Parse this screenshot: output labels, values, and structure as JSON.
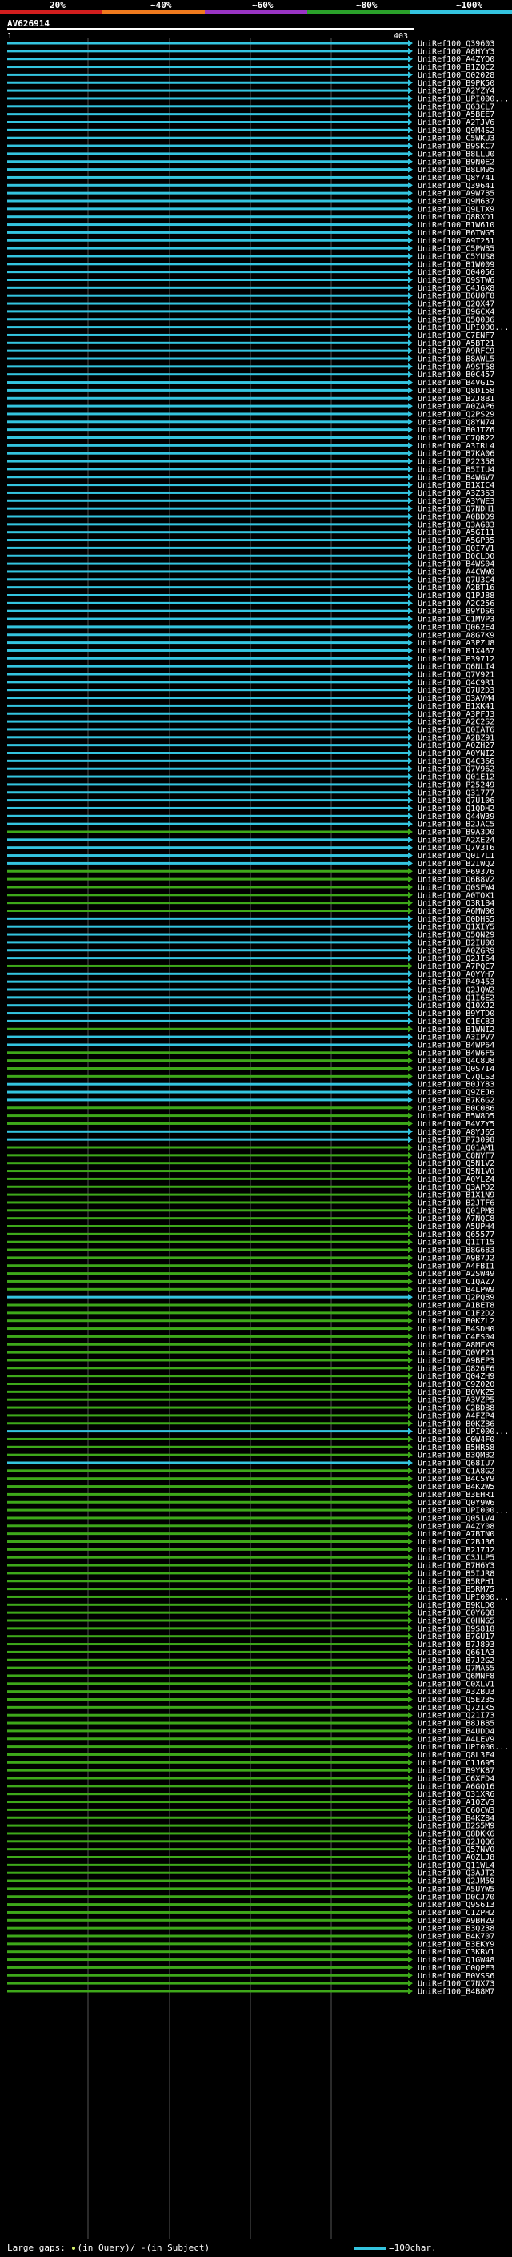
{
  "scale": {
    "labels": [
      "20%",
      "~40%",
      "~60%",
      "~80%",
      "~100%"
    ],
    "colors": [
      "#d21e1e",
      "#f07a1e",
      "#9934c4",
      "#2aa12a",
      "#34c4df"
    ]
  },
  "query": {
    "id": "AV626914",
    "start_label": "1",
    "end_label": "403"
  },
  "colors": {
    "cyan": "#34c4df",
    "green": "#3ea81a",
    "gap": "#d7f26b",
    "grid": "#555555"
  },
  "hits": [
    {
      "id": "UniRef100_Q39603",
      "c": "cyan"
    },
    {
      "id": "UniRef100_A8HYY3",
      "c": "cyan"
    },
    {
      "id": "UniRef100_A4ZYQ0",
      "c": "cyan"
    },
    {
      "id": "UniRef100_B1ZQC2",
      "c": "cyan"
    },
    {
      "id": "UniRef100_Q02028",
      "c": "cyan"
    },
    {
      "id": "UniRef100_B9PK50",
      "c": "cyan"
    },
    {
      "id": "UniRef100_A2YZY4",
      "c": "cyan"
    },
    {
      "id": "UniRef100_UPI000...",
      "c": "cyan"
    },
    {
      "id": "UniRef100_Q63CL7",
      "c": "cyan"
    },
    {
      "id": "UniRef100_A5BEE7",
      "c": "cyan"
    },
    {
      "id": "UniRef100_A2TJV6",
      "c": "cyan"
    },
    {
      "id": "UniRef100_Q9M4S2",
      "c": "cyan"
    },
    {
      "id": "UniRef100_C5WKU3",
      "c": "cyan"
    },
    {
      "id": "UniRef100_B9SKC7",
      "c": "cyan"
    },
    {
      "id": "UniRef100_B8LLU0",
      "c": "cyan"
    },
    {
      "id": "UniRef100_B9N0E2",
      "c": "cyan"
    },
    {
      "id": "UniRef100_B8LM95",
      "c": "cyan"
    },
    {
      "id": "UniRef100_Q8Y741",
      "c": "cyan"
    },
    {
      "id": "UniRef100_Q39641",
      "c": "cyan"
    },
    {
      "id": "UniRef100_A9W7B5",
      "c": "cyan"
    },
    {
      "id": "UniRef100_Q9M637",
      "c": "cyan"
    },
    {
      "id": "UniRef100_Q9LTX9",
      "c": "cyan"
    },
    {
      "id": "UniRef100_Q8RXD1",
      "c": "cyan"
    },
    {
      "id": "UniRef100_B1W610",
      "c": "cyan"
    },
    {
      "id": "UniRef100_B6TWG5",
      "c": "cyan"
    },
    {
      "id": "UniRef100_A9T251",
      "c": "cyan"
    },
    {
      "id": "UniRef100_C5PWB5",
      "c": "cyan"
    },
    {
      "id": "UniRef100_C5YUS8",
      "c": "cyan"
    },
    {
      "id": "UniRef100_B1W009",
      "c": "cyan"
    },
    {
      "id": "UniRef100_Q04056",
      "c": "cyan"
    },
    {
      "id": "UniRef100_Q9STW6",
      "c": "cyan"
    },
    {
      "id": "UniRef100_C4J6X8",
      "c": "cyan"
    },
    {
      "id": "UniRef100_B6U0F8",
      "c": "cyan"
    },
    {
      "id": "UniRef100_Q2QX47",
      "c": "cyan"
    },
    {
      "id": "UniRef100_B9GCX4",
      "c": "cyan"
    },
    {
      "id": "UniRef100_Q5Q036",
      "c": "cyan"
    },
    {
      "id": "UniRef100_UPI000...",
      "c": "cyan"
    },
    {
      "id": "UniRef100_C7ENF7",
      "c": "cyan"
    },
    {
      "id": "UniRef100_A5BT21",
      "c": "cyan"
    },
    {
      "id": "UniRef100_A9RFC9",
      "c": "cyan"
    },
    {
      "id": "UniRef100_B8AWL5",
      "c": "cyan"
    },
    {
      "id": "UniRef100_A9ST58",
      "c": "cyan"
    },
    {
      "id": "UniRef100_B0C457",
      "c": "cyan"
    },
    {
      "id": "UniRef100_B4VG15",
      "c": "cyan"
    },
    {
      "id": "UniRef100_Q8D158",
      "c": "cyan"
    },
    {
      "id": "UniRef100_B2J8B1",
      "c": "cyan"
    },
    {
      "id": "UniRef100_A0ZAP6",
      "c": "cyan"
    },
    {
      "id": "UniRef100_Q2PS29",
      "c": "cyan"
    },
    {
      "id": "UniRef100_Q8YN74",
      "c": "cyan"
    },
    {
      "id": "UniRef100_B0JTZ6",
      "c": "cyan"
    },
    {
      "id": "UniRef100_C7QR22",
      "c": "cyan"
    },
    {
      "id": "UniRef100_A3IRL4",
      "c": "cyan"
    },
    {
      "id": "UniRef100_B7KA06",
      "c": "cyan"
    },
    {
      "id": "UniRef100_P22358",
      "c": "cyan"
    },
    {
      "id": "UniRef100_B5IIU4",
      "c": "cyan"
    },
    {
      "id": "UniRef100_B4WGV7",
      "c": "cyan"
    },
    {
      "id": "UniRef100_B1XIC4",
      "c": "cyan"
    },
    {
      "id": "UniRef100_A3Z3S3",
      "c": "cyan"
    },
    {
      "id": "UniRef100_A3YWE3",
      "c": "cyan"
    },
    {
      "id": "UniRef100_Q7NDH1",
      "c": "cyan"
    },
    {
      "id": "UniRef100_A0BDD9",
      "c": "cyan"
    },
    {
      "id": "UniRef100_Q3AG83",
      "c": "cyan"
    },
    {
      "id": "UniRef100_A5GI11",
      "c": "cyan"
    },
    {
      "id": "UniRef100_A5GP35",
      "c": "cyan"
    },
    {
      "id": "UniRef100_Q0I7V1",
      "c": "cyan"
    },
    {
      "id": "UniRef100_D0CLD0",
      "c": "cyan"
    },
    {
      "id": "UniRef100_B4WS04",
      "c": "cyan"
    },
    {
      "id": "UniRef100_A4CWW0",
      "c": "cyan"
    },
    {
      "id": "UniRef100_Q7U3C4",
      "c": "cyan"
    },
    {
      "id": "UniRef100_A2BT16",
      "c": "cyan"
    },
    {
      "id": "UniRef100_Q1PJ88",
      "c": "cyan"
    },
    {
      "id": "UniRef100_A2C256",
      "c": "cyan"
    },
    {
      "id": "UniRef100_B9YDS6",
      "c": "cyan"
    },
    {
      "id": "UniRef100_C1MVP3",
      "c": "cyan"
    },
    {
      "id": "UniRef100_Q062E4",
      "c": "cyan"
    },
    {
      "id": "UniRef100_A8G7K9",
      "c": "cyan"
    },
    {
      "id": "UniRef100_A3PZU8",
      "c": "cyan"
    },
    {
      "id": "UniRef100_B1X467",
      "c": "cyan"
    },
    {
      "id": "UniRef100_P39712",
      "c": "cyan"
    },
    {
      "id": "UniRef100_Q6NLI4",
      "c": "cyan"
    },
    {
      "id": "UniRef100_Q7V921",
      "c": "cyan"
    },
    {
      "id": "UniRef100_Q4C9R1",
      "c": "cyan"
    },
    {
      "id": "UniRef100_Q7U2D3",
      "c": "cyan"
    },
    {
      "id": "UniRef100_Q3AVM4",
      "c": "cyan"
    },
    {
      "id": "UniRef100_B1XK41",
      "c": "cyan"
    },
    {
      "id": "UniRef100_A3PFJ3",
      "c": "cyan"
    },
    {
      "id": "UniRef100_A2C2S2",
      "c": "cyan"
    },
    {
      "id": "UniRef100_Q0IAT6",
      "c": "cyan"
    },
    {
      "id": "UniRef100_A2BZ91",
      "c": "cyan"
    },
    {
      "id": "UniRef100_A0ZH27",
      "c": "cyan"
    },
    {
      "id": "UniRef100_A0YNI2",
      "c": "cyan"
    },
    {
      "id": "UniRef100_Q4C366",
      "c": "cyan"
    },
    {
      "id": "UniRef100_Q7V962",
      "c": "cyan"
    },
    {
      "id": "UniRef100_Q01E12",
      "c": "cyan"
    },
    {
      "id": "UniRef100_P25249",
      "c": "cyan"
    },
    {
      "id": "UniRef100_Q31777",
      "c": "cyan"
    },
    {
      "id": "UniRef100_Q7U106",
      "c": "cyan"
    },
    {
      "id": "UniRef100_Q1QDH2",
      "c": "cyan"
    },
    {
      "id": "UniRef100_Q44W39",
      "c": "cyan"
    },
    {
      "id": "UniRef100_B2JAC5",
      "c": "cyan"
    },
    {
      "id": "UniRef100_B9A3D0",
      "c": "green"
    },
    {
      "id": "UniRef100_A2XE24",
      "c": "cyan"
    },
    {
      "id": "UniRef100_Q7V3T6",
      "c": "cyan"
    },
    {
      "id": "UniRef100_Q0I7L1",
      "c": "cyan"
    },
    {
      "id": "UniRef100_B2IWQ2",
      "c": "cyan"
    },
    {
      "id": "UniRef100_P69376",
      "c": "green"
    },
    {
      "id": "UniRef100_Q6B8V2",
      "c": "green"
    },
    {
      "id": "UniRef100_Q0SFW4",
      "c": "green"
    },
    {
      "id": "UniRef100_A0TOX1",
      "c": "green"
    },
    {
      "id": "UniRef100_Q3R1B4",
      "c": "green"
    },
    {
      "id": "UniRef100_A6MW00",
      "c": "green"
    },
    {
      "id": "UniRef100_Q0DHS5",
      "c": "cyan"
    },
    {
      "id": "UniRef100_Q1XIY5",
      "c": "cyan"
    },
    {
      "id": "UniRef100_Q5QN29",
      "c": "cyan"
    },
    {
      "id": "UniRef100_B2IU00",
      "c": "cyan"
    },
    {
      "id": "UniRef100_A0ZGR9",
      "c": "cyan"
    },
    {
      "id": "UniRef100_Q2JI64",
      "c": "cyan"
    },
    {
      "id": "UniRef100_A7PQC7",
      "c": "green"
    },
    {
      "id": "UniRef100_A0YYH7",
      "c": "cyan"
    },
    {
      "id": "UniRef100_P49453",
      "c": "cyan"
    },
    {
      "id": "UniRef100_Q2JQW2",
      "c": "cyan"
    },
    {
      "id": "UniRef100_Q1I6E2",
      "c": "cyan"
    },
    {
      "id": "UniRef100_Q10XJ2",
      "c": "cyan"
    },
    {
      "id": "UniRef100_B9YTD0",
      "c": "cyan"
    },
    {
      "id": "UniRef100_C1EC83",
      "c": "cyan"
    },
    {
      "id": "UniRef100_B1WNI2",
      "c": "green"
    },
    {
      "id": "UniRef100_A3IPV7",
      "c": "cyan"
    },
    {
      "id": "UniRef100_B4WP64",
      "c": "cyan"
    },
    {
      "id": "UniRef100_B4W6F5",
      "c": "green"
    },
    {
      "id": "UniRef100_Q4C8U8",
      "c": "green"
    },
    {
      "id": "UniRef100_Q0S7I4",
      "c": "green"
    },
    {
      "id": "UniRef100_C7QLS3",
      "c": "green"
    },
    {
      "id": "UniRef100_B0JY83",
      "c": "cyan"
    },
    {
      "id": "UniRef100_Q9ZEJ6",
      "c": "cyan"
    },
    {
      "id": "UniRef100_B7K6G2",
      "c": "cyan"
    },
    {
      "id": "UniRef100_B0C086",
      "c": "green"
    },
    {
      "id": "UniRef100_B5W8D5",
      "c": "green"
    },
    {
      "id": "UniRef100_B4VZY5",
      "c": "green"
    },
    {
      "id": "UniRef100_A8YJ65",
      "c": "cyan"
    },
    {
      "id": "UniRef100_P73098",
      "c": "cyan"
    },
    {
      "id": "UniRef100_Q01AM1",
      "c": "green"
    },
    {
      "id": "UniRef100_C8NYF7",
      "c": "green"
    },
    {
      "id": "UniRef100_Q5N1V2",
      "c": "green"
    },
    {
      "id": "UniRef100_Q5N1V0",
      "c": "green"
    },
    {
      "id": "UniRef100_A0YLZ4",
      "c": "green"
    },
    {
      "id": "UniRef100_Q3APD2",
      "c": "green"
    },
    {
      "id": "UniRef100_B1X1N9",
      "c": "green"
    },
    {
      "id": "UniRef100_B2JTF6",
      "c": "green"
    },
    {
      "id": "UniRef100_Q01PM8",
      "c": "green"
    },
    {
      "id": "UniRef100_A7NQC8",
      "c": "green"
    },
    {
      "id": "UniRef100_A5UPH4",
      "c": "green"
    },
    {
      "id": "UniRef100_Q65577",
      "c": "green"
    },
    {
      "id": "UniRef100_Q1IT15",
      "c": "green"
    },
    {
      "id": "UniRef100_B8G683",
      "c": "green"
    },
    {
      "id": "UniRef100_A9B7J2",
      "c": "green"
    },
    {
      "id": "UniRef100_A4FBI1",
      "c": "green"
    },
    {
      "id": "UniRef100_A2SW49",
      "c": "green"
    },
    {
      "id": "UniRef100_C1QAZ7",
      "c": "green"
    },
    {
      "id": "UniRef100_B4LPW9",
      "c": "green"
    },
    {
      "id": "UniRef100_Q2PQB9",
      "c": "cyan"
    },
    {
      "id": "UniRef100_A1BET8",
      "c": "green"
    },
    {
      "id": "UniRef100_C1F2D2",
      "c": "green"
    },
    {
      "id": "UniRef100_B0KZL2",
      "c": "green"
    },
    {
      "id": "UniRef100_B4SDH0",
      "c": "green"
    },
    {
      "id": "UniRef100_C4ES04",
      "c": "green"
    },
    {
      "id": "UniRef100_A8MFV9",
      "c": "green"
    },
    {
      "id": "UniRef100_Q0VP21",
      "c": "green"
    },
    {
      "id": "UniRef100_A9BEP3",
      "c": "green"
    },
    {
      "id": "UniRef100_Q826F6",
      "c": "green"
    },
    {
      "id": "UniRef100_Q04ZH9",
      "c": "green"
    },
    {
      "id": "UniRef100_C9Z020",
      "c": "green"
    },
    {
      "id": "UniRef100_B0VKZ5",
      "c": "green"
    },
    {
      "id": "UniRef100_A3VZP5",
      "c": "green"
    },
    {
      "id": "UniRef100_C2BDB8",
      "c": "green"
    },
    {
      "id": "UniRef100_A4FZP4",
      "c": "green"
    },
    {
      "id": "UniRef100_B0KZB6",
      "c": "green"
    },
    {
      "id": "UniRef100_UPI000...",
      "c": "cyan"
    },
    {
      "id": "UniRef100_C0W4F0",
      "c": "green"
    },
    {
      "id": "UniRef100_B5HR58",
      "c": "green"
    },
    {
      "id": "UniRef100_B3QMB2",
      "c": "green"
    },
    {
      "id": "UniRef100_Q68IU7",
      "c": "cyan"
    },
    {
      "id": "UniRef100_C1A8G2",
      "c": "green"
    },
    {
      "id": "UniRef100_B4CSY9",
      "c": "green"
    },
    {
      "id": "UniRef100_B4K2W5",
      "c": "green"
    },
    {
      "id": "UniRef100_B3EHR1",
      "c": "green"
    },
    {
      "id": "UniRef100_Q0Y9W6",
      "c": "green"
    },
    {
      "id": "UniRef100_UPI000...",
      "c": "green"
    },
    {
      "id": "UniRef100_Q051V4",
      "c": "green"
    },
    {
      "id": "UniRef100_A4ZY08",
      "c": "green"
    },
    {
      "id": "UniRef100_A7BTN0",
      "c": "green"
    },
    {
      "id": "UniRef100_C2BJ36",
      "c": "green"
    },
    {
      "id": "UniRef100_B2J7J2",
      "c": "green"
    },
    {
      "id": "UniRef100_C3JLP5",
      "c": "green"
    },
    {
      "id": "UniRef100_B7H6Y3",
      "c": "green"
    },
    {
      "id": "UniRef100_B5IJR8",
      "c": "green"
    },
    {
      "id": "UniRef100_B5RPH1",
      "c": "green"
    },
    {
      "id": "UniRef100_B5RM75",
      "c": "green"
    },
    {
      "id": "UniRef100_UPI000...",
      "c": "green"
    },
    {
      "id": "UniRef100_B9KLD0",
      "c": "green"
    },
    {
      "id": "UniRef100_C0Y6Q8",
      "c": "green"
    },
    {
      "id": "UniRef100_C0HNG5",
      "c": "green"
    },
    {
      "id": "UniRef100_B9S818",
      "c": "green"
    },
    {
      "id": "UniRef100_B7GU17",
      "c": "green"
    },
    {
      "id": "UniRef100_B7J893",
      "c": "green"
    },
    {
      "id": "UniRef100_Q661A3",
      "c": "green"
    },
    {
      "id": "UniRef100_B7J2G2",
      "c": "green"
    },
    {
      "id": "UniRef100_Q7MA55",
      "c": "green"
    },
    {
      "id": "UniRef100_Q6MNF8",
      "c": "green"
    },
    {
      "id": "UniRef100_C0XLV1",
      "c": "green"
    },
    {
      "id": "UniRef100_A3ZBU3",
      "c": "green"
    },
    {
      "id": "UniRef100_Q5E235",
      "c": "green"
    },
    {
      "id": "UniRef100_Q72IK5",
      "c": "green"
    },
    {
      "id": "UniRef100_Q21I73",
      "c": "green"
    },
    {
      "id": "UniRef100_B8JBB5",
      "c": "green"
    },
    {
      "id": "UniRef100_B4UDD4",
      "c": "green"
    },
    {
      "id": "UniRef100_A4LEV9",
      "c": "green"
    },
    {
      "id": "UniRef100_UPI000...",
      "c": "green"
    },
    {
      "id": "UniRef100_Q8L3F4",
      "c": "green"
    },
    {
      "id": "UniRef100_C1J695",
      "c": "green"
    },
    {
      "id": "UniRef100_B9YK87",
      "c": "green"
    },
    {
      "id": "UniRef100_C6XFD4",
      "c": "green"
    },
    {
      "id": "UniRef100_A6GQ16",
      "c": "green"
    },
    {
      "id": "UniRef100_Q31XR6",
      "c": "green"
    },
    {
      "id": "UniRef100_A1QZV3",
      "c": "green"
    },
    {
      "id": "UniRef100_C6QCW3",
      "c": "green"
    },
    {
      "id": "UniRef100_B4KZ84",
      "c": "green"
    },
    {
      "id": "UniRef100_B2S5M9",
      "c": "green"
    },
    {
      "id": "UniRef100_Q8DKK6",
      "c": "green"
    },
    {
      "id": "UniRef100_Q2JQQ6",
      "c": "green"
    },
    {
      "id": "UniRef100_Q57NV0",
      "c": "green"
    },
    {
      "id": "UniRef100_A0ZLJ8",
      "c": "green"
    },
    {
      "id": "UniRef100_Q11WL4",
      "c": "green"
    },
    {
      "id": "UniRef100_Q3AJT2",
      "c": "green"
    },
    {
      "id": "UniRef100_Q2JM59",
      "c": "green"
    },
    {
      "id": "UniRef100_A5UYW5",
      "c": "green"
    },
    {
      "id": "UniRef100_D0CJ70",
      "c": "green"
    },
    {
      "id": "UniRef100_Q9S613",
      "c": "green"
    },
    {
      "id": "UniRef100_C1ZPH2",
      "c": "green"
    },
    {
      "id": "UniRef100_A9BHZ9",
      "c": "green"
    },
    {
      "id": "UniRef100_B3Q238",
      "c": "green"
    },
    {
      "id": "UniRef100_B4K707",
      "c": "green"
    },
    {
      "id": "UniRef100_B3EKY9",
      "c": "green"
    },
    {
      "id": "UniRef100_C3KRV1",
      "c": "green"
    },
    {
      "id": "UniRef100_Q1GW48",
      "c": "green"
    },
    {
      "id": "UniRef100_C0QPE3",
      "c": "green"
    },
    {
      "id": "UniRef100_B0VSS6",
      "c": "green"
    },
    {
      "id": "UniRef100_C7NX73",
      "c": "green"
    },
    {
      "id": "UniRef100_B4B8M7",
      "c": "green"
    }
  ],
  "footer": {
    "legend": "Large gaps:",
    "legend_query": "(in Query)/",
    "legend_subject": "(in Subject)",
    "scale_label": "=100char."
  }
}
